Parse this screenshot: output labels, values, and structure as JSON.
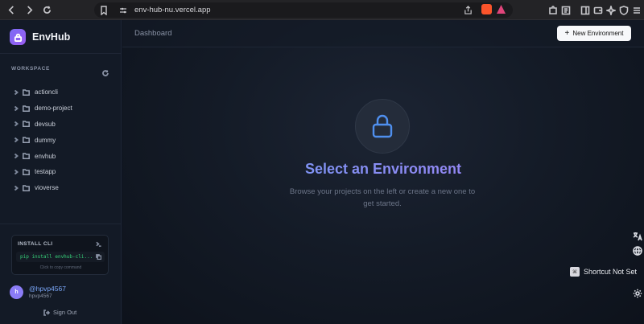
{
  "browser": {
    "url": "env-hub-nu.vercel.app"
  },
  "sidebar": {
    "brand": "EnvHub",
    "workspace_label": "WORKSPACE",
    "projects": [
      {
        "name": "actioncli"
      },
      {
        "name": "demo-project"
      },
      {
        "name": "devsub"
      },
      {
        "name": "dummy"
      },
      {
        "name": "envhub"
      },
      {
        "name": "testapp"
      },
      {
        "name": "vioverse"
      }
    ],
    "cli": {
      "title": "INSTALL CLI",
      "command": "pip install envhub-cli...",
      "hint": "Click to copy command"
    },
    "user": {
      "avatar_letter": "h",
      "handle": "@hpvp4567",
      "name": "hpvp4567"
    },
    "signout_label": "Sign Out"
  },
  "main": {
    "breadcrumb": "Dashboard",
    "new_env_label": "New Environment",
    "new_env_plus": "+",
    "hero_title": "Select an Environment",
    "hero_subtitle": "Browse your projects on the left or create a new one to get started."
  },
  "overlay": {
    "shortcut_label": "Shortcut Not Set"
  },
  "colors": {
    "accent_blue": "#4f8fee",
    "accent_purple": "#9a5cf0",
    "cli_green": "#36d37a"
  }
}
